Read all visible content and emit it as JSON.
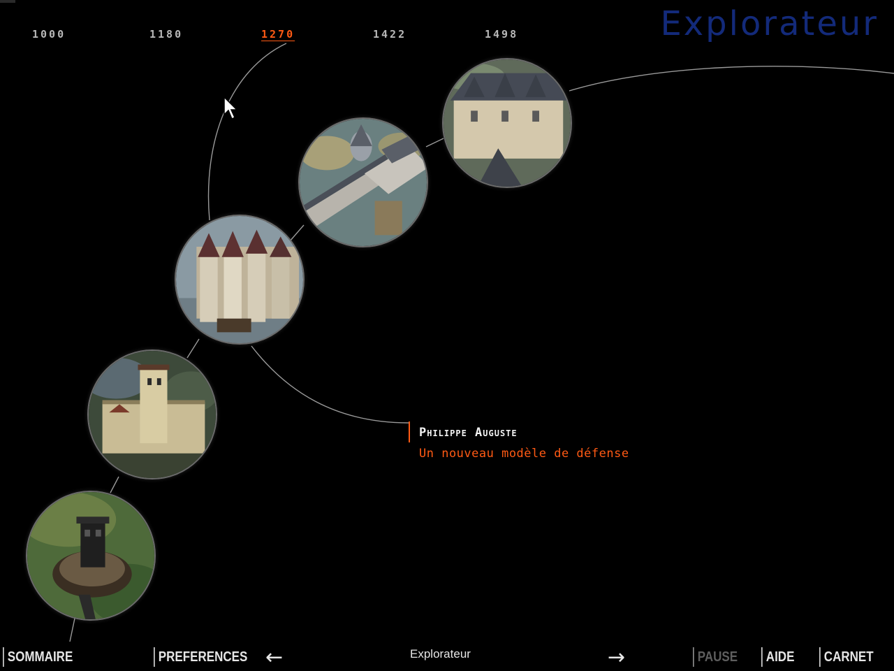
{
  "header": {
    "app_title": "Explorateur",
    "timeline_years": [
      "1000",
      "1180",
      "1270",
      "1422",
      "1498"
    ],
    "active_year": "1270"
  },
  "caption": {
    "title": "Philippe Auguste",
    "subtitle": "Un nouveau modèle de défense"
  },
  "footer": {
    "sommaire": "SOMMAIRE",
    "preferences": "PREFERENCES",
    "section": "Explorateur",
    "pause": "PAUSE",
    "aide": "AIDE",
    "carnet": "CARNET",
    "prev_icon": "arrow-left-icon",
    "next_icon": "arrow-right-icon"
  },
  "colors": {
    "accent": "#ff5a14",
    "title_blue": "#132a7a",
    "background": "#000000"
  }
}
